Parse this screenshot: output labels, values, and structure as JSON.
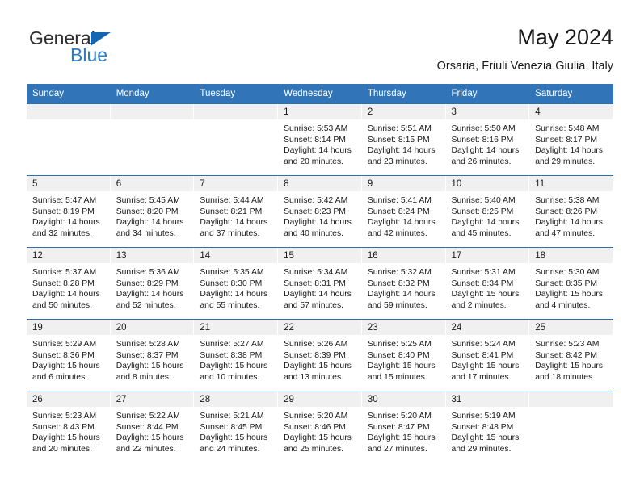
{
  "brand": {
    "name_part1": "General",
    "name_part2": "Blue",
    "triangle_icon": "blue-triangle-logo-mark",
    "colors": {
      "dark": "#2e2e2e",
      "blue": "#2b7cc4",
      "triangle": "#1565b0"
    }
  },
  "header": {
    "title": "May 2024",
    "subtitle": "Orsaria, Friuli Venezia Giulia, Italy"
  },
  "calendar": {
    "accent_color": "#3175b8",
    "daynum_band_color": "#f0f0f0",
    "weekday_headers": [
      "Sunday",
      "Monday",
      "Tuesday",
      "Wednesday",
      "Thursday",
      "Friday",
      "Saturday"
    ],
    "weeks": [
      [
        {
          "day": "",
          "sunrise": "",
          "sunset": "",
          "daylight_line1": "",
          "daylight_line2": "",
          "empty": true
        },
        {
          "day": "",
          "sunrise": "",
          "sunset": "",
          "daylight_line1": "",
          "daylight_line2": "",
          "empty": true
        },
        {
          "day": "",
          "sunrise": "",
          "sunset": "",
          "daylight_line1": "",
          "daylight_line2": "",
          "empty": true
        },
        {
          "day": "1",
          "sunrise": "Sunrise: 5:53 AM",
          "sunset": "Sunset: 8:14 PM",
          "daylight_line1": "Daylight: 14 hours",
          "daylight_line2": "and 20 minutes.",
          "empty": false
        },
        {
          "day": "2",
          "sunrise": "Sunrise: 5:51 AM",
          "sunset": "Sunset: 8:15 PM",
          "daylight_line1": "Daylight: 14 hours",
          "daylight_line2": "and 23 minutes.",
          "empty": false
        },
        {
          "day": "3",
          "sunrise": "Sunrise: 5:50 AM",
          "sunset": "Sunset: 8:16 PM",
          "daylight_line1": "Daylight: 14 hours",
          "daylight_line2": "and 26 minutes.",
          "empty": false
        },
        {
          "day": "4",
          "sunrise": "Sunrise: 5:48 AM",
          "sunset": "Sunset: 8:17 PM",
          "daylight_line1": "Daylight: 14 hours",
          "daylight_line2": "and 29 minutes.",
          "empty": false
        }
      ],
      [
        {
          "day": "5",
          "sunrise": "Sunrise: 5:47 AM",
          "sunset": "Sunset: 8:19 PM",
          "daylight_line1": "Daylight: 14 hours",
          "daylight_line2": "and 32 minutes.",
          "empty": false
        },
        {
          "day": "6",
          "sunrise": "Sunrise: 5:45 AM",
          "sunset": "Sunset: 8:20 PM",
          "daylight_line1": "Daylight: 14 hours",
          "daylight_line2": "and 34 minutes.",
          "empty": false
        },
        {
          "day": "7",
          "sunrise": "Sunrise: 5:44 AM",
          "sunset": "Sunset: 8:21 PM",
          "daylight_line1": "Daylight: 14 hours",
          "daylight_line2": "and 37 minutes.",
          "empty": false
        },
        {
          "day": "8",
          "sunrise": "Sunrise: 5:42 AM",
          "sunset": "Sunset: 8:23 PM",
          "daylight_line1": "Daylight: 14 hours",
          "daylight_line2": "and 40 minutes.",
          "empty": false
        },
        {
          "day": "9",
          "sunrise": "Sunrise: 5:41 AM",
          "sunset": "Sunset: 8:24 PM",
          "daylight_line1": "Daylight: 14 hours",
          "daylight_line2": "and 42 minutes.",
          "empty": false
        },
        {
          "day": "10",
          "sunrise": "Sunrise: 5:40 AM",
          "sunset": "Sunset: 8:25 PM",
          "daylight_line1": "Daylight: 14 hours",
          "daylight_line2": "and 45 minutes.",
          "empty": false
        },
        {
          "day": "11",
          "sunrise": "Sunrise: 5:38 AM",
          "sunset": "Sunset: 8:26 PM",
          "daylight_line1": "Daylight: 14 hours",
          "daylight_line2": "and 47 minutes.",
          "empty": false
        }
      ],
      [
        {
          "day": "12",
          "sunrise": "Sunrise: 5:37 AM",
          "sunset": "Sunset: 8:28 PM",
          "daylight_line1": "Daylight: 14 hours",
          "daylight_line2": "and 50 minutes.",
          "empty": false
        },
        {
          "day": "13",
          "sunrise": "Sunrise: 5:36 AM",
          "sunset": "Sunset: 8:29 PM",
          "daylight_line1": "Daylight: 14 hours",
          "daylight_line2": "and 52 minutes.",
          "empty": false
        },
        {
          "day": "14",
          "sunrise": "Sunrise: 5:35 AM",
          "sunset": "Sunset: 8:30 PM",
          "daylight_line1": "Daylight: 14 hours",
          "daylight_line2": "and 55 minutes.",
          "empty": false
        },
        {
          "day": "15",
          "sunrise": "Sunrise: 5:34 AM",
          "sunset": "Sunset: 8:31 PM",
          "daylight_line1": "Daylight: 14 hours",
          "daylight_line2": "and 57 minutes.",
          "empty": false
        },
        {
          "day": "16",
          "sunrise": "Sunrise: 5:32 AM",
          "sunset": "Sunset: 8:32 PM",
          "daylight_line1": "Daylight: 14 hours",
          "daylight_line2": "and 59 minutes.",
          "empty": false
        },
        {
          "day": "17",
          "sunrise": "Sunrise: 5:31 AM",
          "sunset": "Sunset: 8:34 PM",
          "daylight_line1": "Daylight: 15 hours",
          "daylight_line2": "and 2 minutes.",
          "empty": false
        },
        {
          "day": "18",
          "sunrise": "Sunrise: 5:30 AM",
          "sunset": "Sunset: 8:35 PM",
          "daylight_line1": "Daylight: 15 hours",
          "daylight_line2": "and 4 minutes.",
          "empty": false
        }
      ],
      [
        {
          "day": "19",
          "sunrise": "Sunrise: 5:29 AM",
          "sunset": "Sunset: 8:36 PM",
          "daylight_line1": "Daylight: 15 hours",
          "daylight_line2": "and 6 minutes.",
          "empty": false
        },
        {
          "day": "20",
          "sunrise": "Sunrise: 5:28 AM",
          "sunset": "Sunset: 8:37 PM",
          "daylight_line1": "Daylight: 15 hours",
          "daylight_line2": "and 8 minutes.",
          "empty": false
        },
        {
          "day": "21",
          "sunrise": "Sunrise: 5:27 AM",
          "sunset": "Sunset: 8:38 PM",
          "daylight_line1": "Daylight: 15 hours",
          "daylight_line2": "and 10 minutes.",
          "empty": false
        },
        {
          "day": "22",
          "sunrise": "Sunrise: 5:26 AM",
          "sunset": "Sunset: 8:39 PM",
          "daylight_line1": "Daylight: 15 hours",
          "daylight_line2": "and 13 minutes.",
          "empty": false
        },
        {
          "day": "23",
          "sunrise": "Sunrise: 5:25 AM",
          "sunset": "Sunset: 8:40 PM",
          "daylight_line1": "Daylight: 15 hours",
          "daylight_line2": "and 15 minutes.",
          "empty": false
        },
        {
          "day": "24",
          "sunrise": "Sunrise: 5:24 AM",
          "sunset": "Sunset: 8:41 PM",
          "daylight_line1": "Daylight: 15 hours",
          "daylight_line2": "and 17 minutes.",
          "empty": false
        },
        {
          "day": "25",
          "sunrise": "Sunrise: 5:23 AM",
          "sunset": "Sunset: 8:42 PM",
          "daylight_line1": "Daylight: 15 hours",
          "daylight_line2": "and 18 minutes.",
          "empty": false
        }
      ],
      [
        {
          "day": "26",
          "sunrise": "Sunrise: 5:23 AM",
          "sunset": "Sunset: 8:43 PM",
          "daylight_line1": "Daylight: 15 hours",
          "daylight_line2": "and 20 minutes.",
          "empty": false
        },
        {
          "day": "27",
          "sunrise": "Sunrise: 5:22 AM",
          "sunset": "Sunset: 8:44 PM",
          "daylight_line1": "Daylight: 15 hours",
          "daylight_line2": "and 22 minutes.",
          "empty": false
        },
        {
          "day": "28",
          "sunrise": "Sunrise: 5:21 AM",
          "sunset": "Sunset: 8:45 PM",
          "daylight_line1": "Daylight: 15 hours",
          "daylight_line2": "and 24 minutes.",
          "empty": false
        },
        {
          "day": "29",
          "sunrise": "Sunrise: 5:20 AM",
          "sunset": "Sunset: 8:46 PM",
          "daylight_line1": "Daylight: 15 hours",
          "daylight_line2": "and 25 minutes.",
          "empty": false
        },
        {
          "day": "30",
          "sunrise": "Sunrise: 5:20 AM",
          "sunset": "Sunset: 8:47 PM",
          "daylight_line1": "Daylight: 15 hours",
          "daylight_line2": "and 27 minutes.",
          "empty": false
        },
        {
          "day": "31",
          "sunrise": "Sunrise: 5:19 AM",
          "sunset": "Sunset: 8:48 PM",
          "daylight_line1": "Daylight: 15 hours",
          "daylight_line2": "and 29 minutes.",
          "empty": false
        },
        {
          "day": "",
          "sunrise": "",
          "sunset": "",
          "daylight_line1": "",
          "daylight_line2": "",
          "empty": true
        }
      ]
    ]
  }
}
